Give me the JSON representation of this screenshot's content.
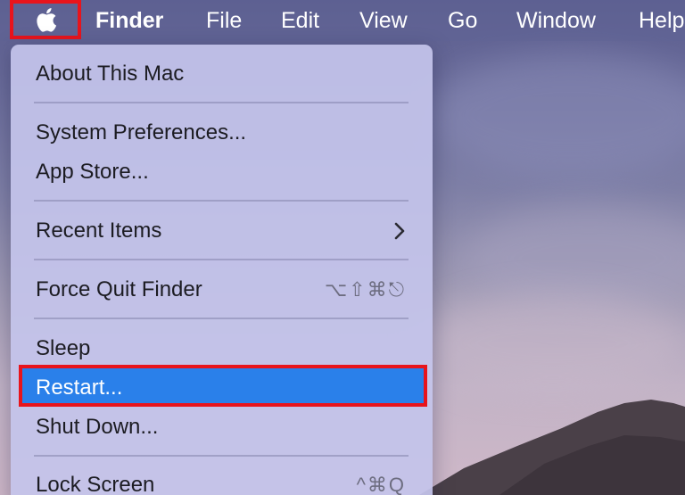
{
  "menubar": {
    "apple_icon": "apple-logo-icon",
    "items": [
      "Finder",
      "File",
      "Edit",
      "View",
      "Go",
      "Window",
      "Help"
    ]
  },
  "apple_menu": {
    "items": [
      {
        "label": "About This Mac"
      },
      {
        "label": "System Preferences..."
      },
      {
        "label": "App Store..."
      },
      {
        "label": "Recent Items",
        "submenu_icon": "chevron-right-icon"
      },
      {
        "label": "Force Quit Finder",
        "shortcut": "⌥⇧⌘⎋"
      },
      {
        "label": "Sleep"
      },
      {
        "label": "Restart...",
        "selected": true
      },
      {
        "label": "Shut Down..."
      },
      {
        "label": "Lock Screen",
        "shortcut": "^⌘Q"
      }
    ]
  },
  "colors": {
    "highlight": "#2a80ea",
    "annotation_box": "#e8141c",
    "menu_background": "#c4c4eb"
  }
}
